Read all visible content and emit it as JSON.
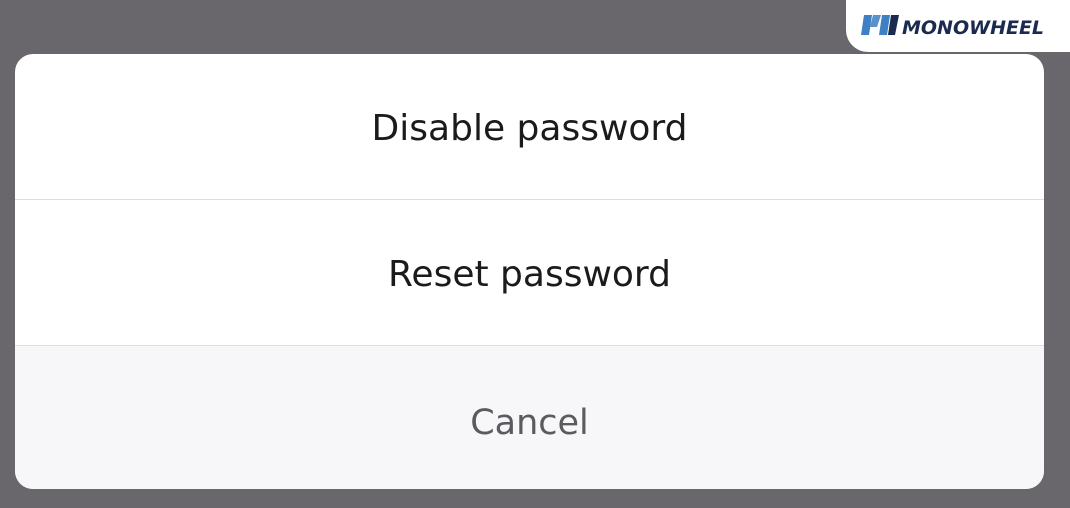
{
  "dialog": {
    "actions": [
      {
        "id": "disable",
        "label": "Disable password"
      },
      {
        "id": "reset",
        "label": "Reset password"
      },
      {
        "id": "cancel",
        "label": "Cancel"
      }
    ]
  },
  "watermark": {
    "brand": "MONOWHEEL",
    "icon": "monowheel-logo-icon",
    "colors": {
      "blue": "#3f7fc3",
      "dark": "#1c2a4f"
    }
  },
  "colors": {
    "backdrop": "#69676b",
    "sheet": "#ffffff",
    "cancel_row": "#f7f6f9",
    "separator": "#dedde2",
    "action_text": "#1b1b1d",
    "cancel_text": "#5b5a5f"
  }
}
